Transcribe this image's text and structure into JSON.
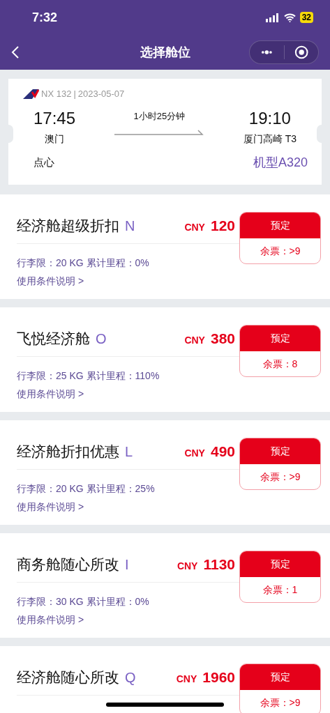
{
  "status_bar": {
    "time": "7:32",
    "battery": "32"
  },
  "nav": {
    "title": "选择舱位"
  },
  "flight": {
    "number": "NX 132",
    "separator": "|",
    "date": "2023-05-07",
    "depart_time": "17:45",
    "depart_city": "澳门",
    "duration": "1小时25分钟",
    "arrive_time": "19:10",
    "arrive_city": "厦门高崎 T3",
    "meal": "点心",
    "aircraft": "机型A320"
  },
  "fares": [
    {
      "name": "经济舱超级折扣",
      "code": "N",
      "currency": "CNY",
      "price": "120",
      "book": "预定",
      "remaining": "余票：>9",
      "baggage": "行李限：20 KG 累计里程：0%",
      "terms": "使用条件说明 >"
    },
    {
      "name": "飞悦经济舱",
      "code": "O",
      "currency": "CNY",
      "price": "380",
      "book": "预定",
      "remaining": "余票：8",
      "baggage": "行李限：25 KG 累计里程：110%",
      "terms": "使用条件说明 >"
    },
    {
      "name": "经济舱折扣优惠",
      "code": "L",
      "currency": "CNY",
      "price": "490",
      "book": "预定",
      "remaining": "余票：>9",
      "baggage": "行李限：20 KG 累计里程：25%",
      "terms": "使用条件说明 >"
    },
    {
      "name": "商务舱随心所改",
      "code": "I",
      "currency": "CNY",
      "price": "1130",
      "book": "预定",
      "remaining": "余票：1",
      "baggage": "行李限：30 KG 累计里程：0%",
      "terms": "使用条件说明 >"
    },
    {
      "name": "经济舱随心所改",
      "code": "Q",
      "currency": "CNY",
      "price": "1960",
      "book": "预定",
      "remaining": "余票：>9"
    }
  ]
}
